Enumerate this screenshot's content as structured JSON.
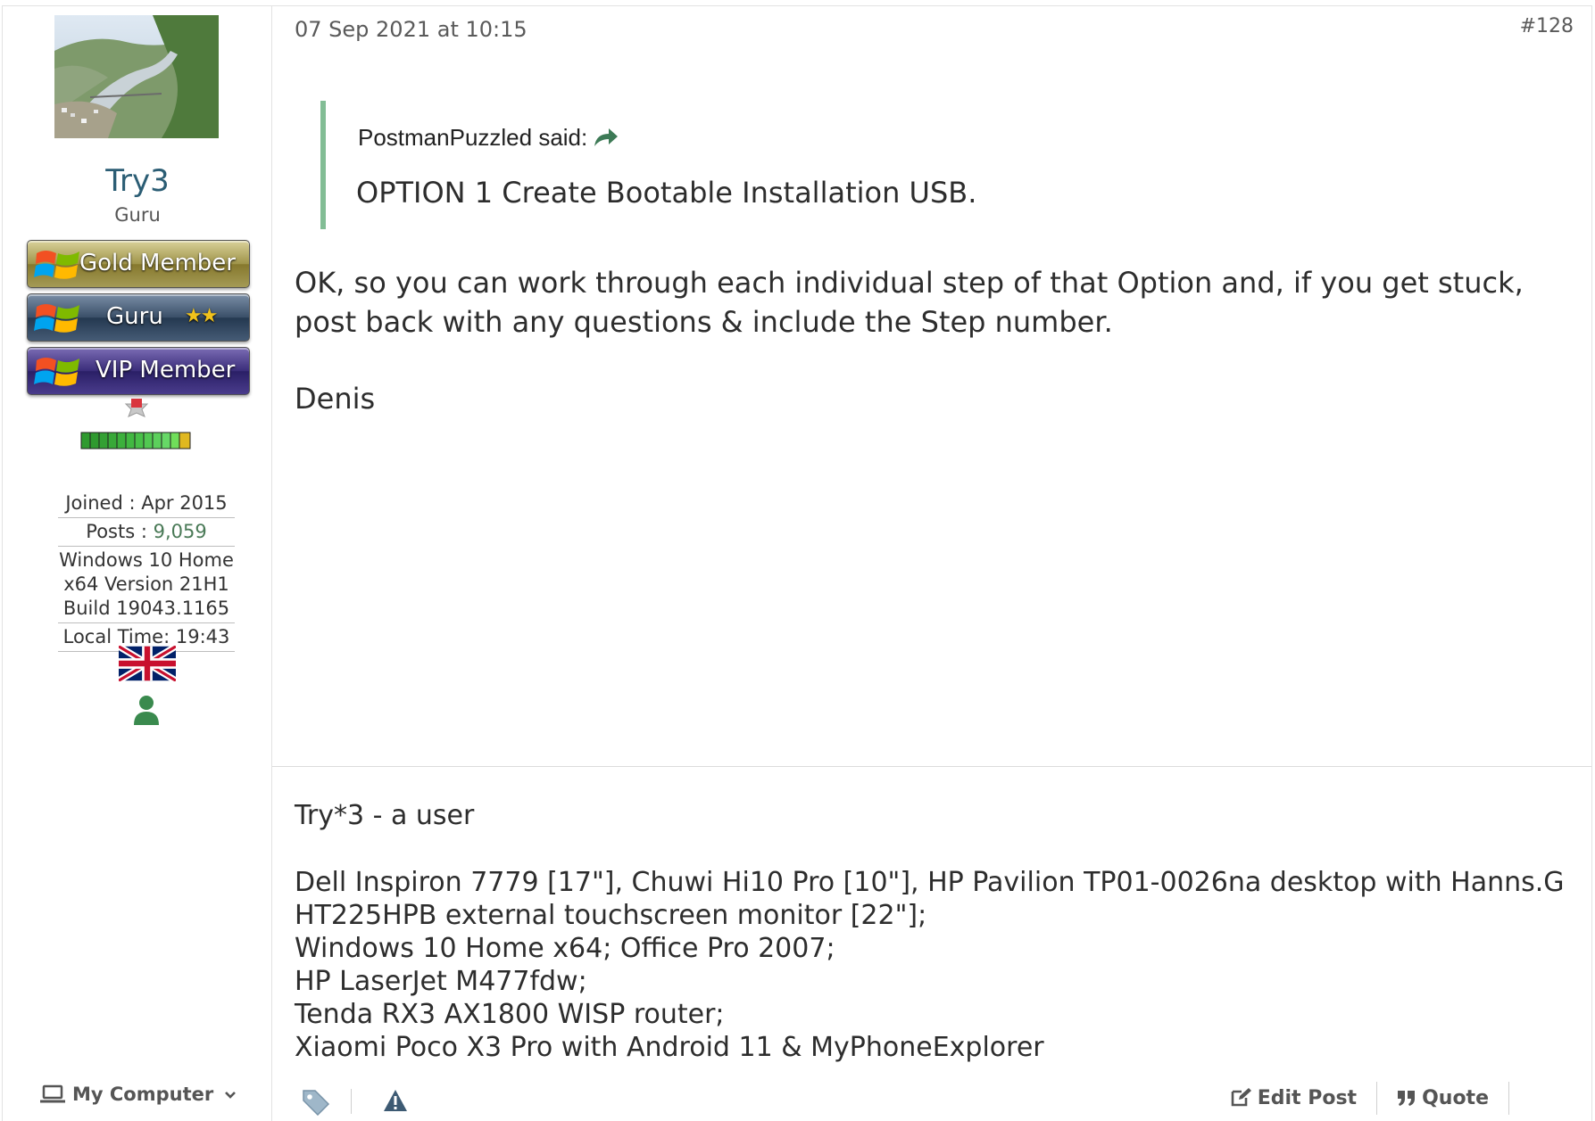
{
  "user": {
    "name": "Try3",
    "title": "Guru",
    "banners": [
      {
        "label": "Gold Member"
      },
      {
        "label": "Guru",
        "stars": "★★"
      },
      {
        "label": "VIP Member"
      }
    ],
    "joined": "Joined : Apr 2015",
    "posts_label": "Posts : ",
    "posts_value": "9,059",
    "system_line1": "Windows 10 Home",
    "system_line2": "x64 Version 21H1",
    "system_line3": "Build 19043.1165",
    "local_time": "Local Time: 19:43",
    "my_computer_label": "My Computer"
  },
  "post": {
    "date": "07 Sep 2021 at 10:15",
    "number": "#128",
    "quote_author": "PostmanPuzzled said:",
    "quote_text": "OPTION 1 Create Bootable Installation USB.",
    "body_paragraph1": "OK, so you can work through each individual step of that Option and, if you get stuck, post back with any questions & include the Step number.",
    "body_paragraph2": "Denis"
  },
  "signature": {
    "title": "Try*3 - a user",
    "lines": [
      "Dell Inspiron 7779 [17\"], Chuwi Hi10 Pro [10\"], HP Pavilion TP01-0026na desktop with Hanns.G HT225HPB external touchscreen monitor [22\"];",
      "Windows 10 Home x64; Office Pro 2007;",
      "HP LaserJet M477fdw;",
      "Tenda RX3 AX1800 WISP router;",
      "Xiaomi Poco X3 Pro with Android 11 & MyPhoneExplorer"
    ]
  },
  "actions": {
    "edit_label": "Edit Post",
    "quote_label": "Quote"
  },
  "colors": {
    "username": "#2b5d74",
    "quote_border": "#82bd95",
    "posts_value": "#4a7a57",
    "person_icon": "#3a8a4e"
  }
}
